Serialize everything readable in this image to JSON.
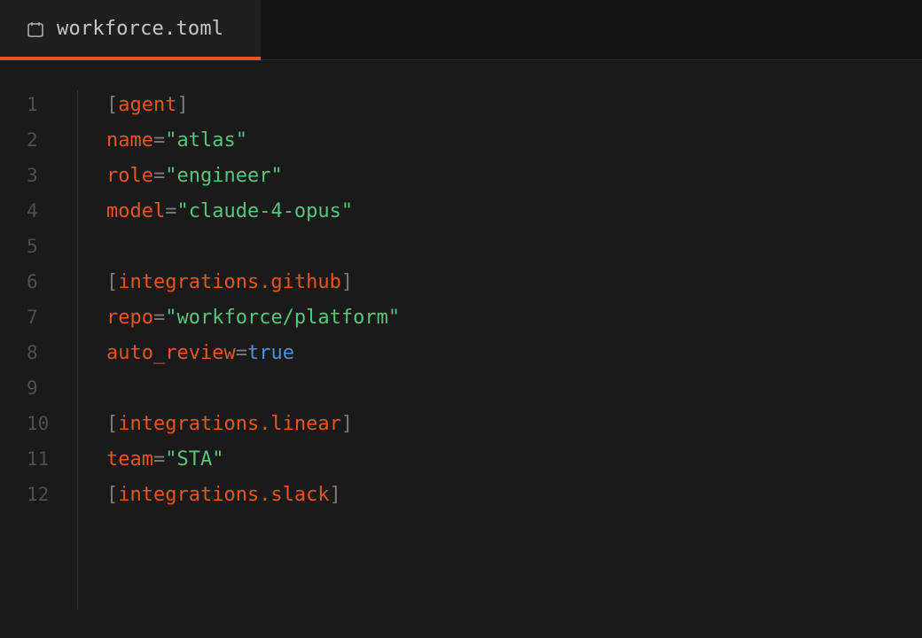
{
  "tab": {
    "icon": "file-icon",
    "label": "workforce.toml"
  },
  "colors": {
    "accent": "#e8551e",
    "string": "#54c878",
    "boolean": "#4f8fe0",
    "punctuation": "#7a7a7a",
    "line_number": "#4f4f4f",
    "background": "#1a1a1a"
  },
  "lines": [
    {
      "num": "1",
      "segments": [
        {
          "t": "[",
          "c": "bracket"
        },
        {
          "t": "agent",
          "c": "key"
        },
        {
          "t": "]",
          "c": "bracket"
        }
      ]
    },
    {
      "num": "2",
      "segments": [
        {
          "t": "name",
          "c": "key"
        },
        {
          "t": "=",
          "c": "eq"
        },
        {
          "t": "\"atlas\"",
          "c": "str"
        }
      ]
    },
    {
      "num": "3",
      "segments": [
        {
          "t": "role",
          "c": "key"
        },
        {
          "t": "=",
          "c": "eq"
        },
        {
          "t": "\"engineer\"",
          "c": "str"
        }
      ]
    },
    {
      "num": "4",
      "segments": [
        {
          "t": "model",
          "c": "key"
        },
        {
          "t": "=",
          "c": "eq"
        },
        {
          "t": "\"claude-4-opus\"",
          "c": "str"
        }
      ]
    },
    {
      "num": "5",
      "segments": []
    },
    {
      "num": "6",
      "segments": [
        {
          "t": "[",
          "c": "bracket"
        },
        {
          "t": "integrations.github",
          "c": "key"
        },
        {
          "t": "]",
          "c": "bracket"
        }
      ]
    },
    {
      "num": "7",
      "segments": [
        {
          "t": "repo",
          "c": "key"
        },
        {
          "t": "=",
          "c": "eq"
        },
        {
          "t": "\"workforce/platform\"",
          "c": "str"
        }
      ]
    },
    {
      "num": "8",
      "segments": [
        {
          "t": "auto_review",
          "c": "key"
        },
        {
          "t": "=",
          "c": "eq"
        },
        {
          "t": "true",
          "c": "bool"
        }
      ]
    },
    {
      "num": "9",
      "segments": []
    },
    {
      "num": "10",
      "segments": [
        {
          "t": "[",
          "c": "bracket"
        },
        {
          "t": "integrations.linear",
          "c": "key"
        },
        {
          "t": "]",
          "c": "bracket"
        }
      ]
    },
    {
      "num": "11",
      "segments": [
        {
          "t": "team",
          "c": "key"
        },
        {
          "t": "=",
          "c": "eq"
        },
        {
          "t": "\"STA\"",
          "c": "str"
        }
      ]
    },
    {
      "num": "12",
      "segments": [
        {
          "t": "[",
          "c": "bracket"
        },
        {
          "t": "integrations.slack",
          "c": "key"
        },
        {
          "t": "]",
          "c": "bracket"
        }
      ]
    }
  ]
}
